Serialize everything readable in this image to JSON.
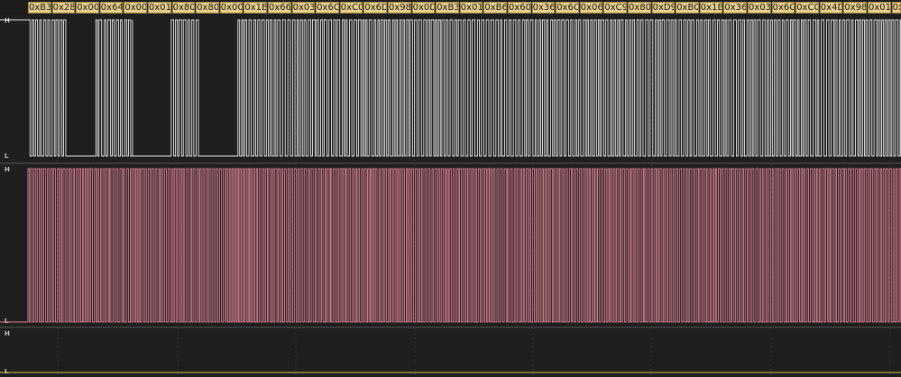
{
  "decoded_bytes": [
    "0xB3",
    "0x28",
    "0x00",
    "0x64",
    "0x00",
    "0x01",
    "0x80",
    "0x80",
    "0x00",
    "0x1B",
    "0x66",
    "0x03",
    "0x6C",
    "0xC0",
    "0x6D",
    "0x98",
    "0x0D",
    "0xB3",
    "0x01",
    "0xB6",
    "0x60",
    "0x36",
    "0x6C",
    "0x06",
    "0xC9",
    "0x80",
    "0xD9",
    "0xB0",
    "0x1B",
    "0x36",
    "0x03",
    "0x6C",
    "0xC0",
    "0x4D",
    "0x98",
    "0x01",
    "0x0"
  ],
  "channels": [
    {
      "high_label": "H",
      "low_label": "L",
      "trace_color": "#e6e6e6"
    },
    {
      "high_label": "H",
      "low_label": "L",
      "trace_color": "#d98090"
    },
    {
      "high_label": "H",
      "low_label": "L",
      "trace_color": "#d9c84a"
    }
  ],
  "colors": {
    "background": "#1f1f1f",
    "decode_box": "#e7cf8d",
    "grid": "#3a3a3a"
  }
}
